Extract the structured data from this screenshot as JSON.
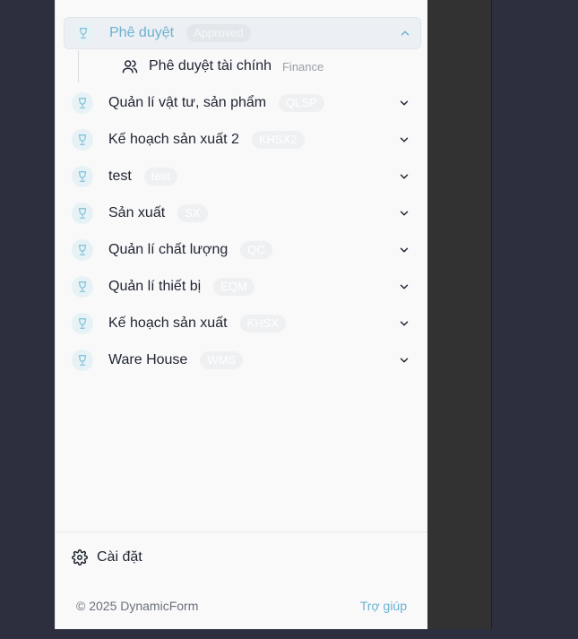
{
  "sidebar": {
    "modules": [
      {
        "label": "Phê duyệt",
        "code": "Approved",
        "expanded": true
      },
      {
        "label": "Quản lí vật tư, sản phẩm",
        "code": "QLSP",
        "expanded": false
      },
      {
        "label": "Kế hoạch sản xuất 2",
        "code": "KHSX2",
        "expanded": false
      },
      {
        "label": "test",
        "code": "test",
        "expanded": false
      },
      {
        "label": "Sản xuất",
        "code": "SX",
        "expanded": false
      },
      {
        "label": "Quản lí chất lượng",
        "code": "QC",
        "expanded": false
      },
      {
        "label": "Quản lí thiết bị",
        "code": "EQM",
        "expanded": false
      },
      {
        "label": "Kế hoạch sản xuất",
        "code": "KHSX",
        "expanded": false
      },
      {
        "label": "Ware House",
        "code": "WMS",
        "expanded": false
      }
    ],
    "sub_item": {
      "label": "Phê duyệt tài chính",
      "code": "Finance"
    }
  },
  "footer": {
    "settings_label": "Cài đặt",
    "copyright": "© 2025 DynamicForm",
    "help_label": "Trợ giúp"
  },
  "colors": {
    "accent": "#6bb2cf",
    "sidebar_bg": "#f9f9fa",
    "page_bg": "#2e2f3e"
  }
}
